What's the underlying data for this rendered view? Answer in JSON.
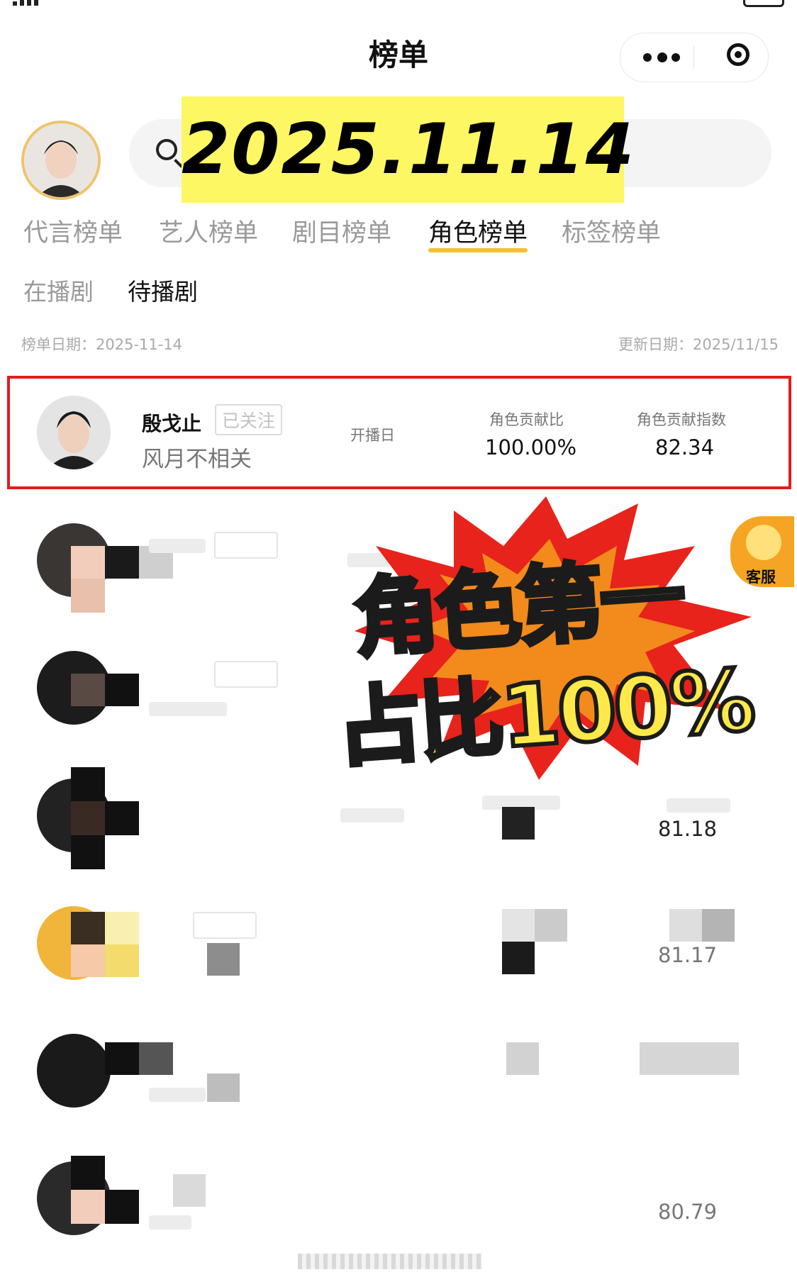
{
  "nav": {
    "title": "榜单"
  },
  "header": {
    "search_icon": "search-icon",
    "date_banner": "2025.11.14"
  },
  "tabs": [
    {
      "label": "代言榜单",
      "active": false
    },
    {
      "label": "艺人榜单",
      "active": false
    },
    {
      "label": "剧目榜单",
      "active": false
    },
    {
      "label": "角色榜单",
      "active": true
    },
    {
      "label": "标签榜单",
      "active": false
    }
  ],
  "subtabs": [
    {
      "label": "在播剧",
      "active": false
    },
    {
      "label": "待播剧",
      "active": true
    }
  ],
  "meta": {
    "list_date": "榜单日期：2025-11-14",
    "update_date": "更新日期：2025/11/15"
  },
  "columns": {
    "start_date": "开播日",
    "contribution_ratio": "角色贡献比",
    "contribution_index": "角色贡献指数"
  },
  "rows": [
    {
      "name": "殷戈止",
      "follow": "已关注",
      "drama": "风月不相关",
      "ratio": "100.00%",
      "index": "82.34",
      "highlighted": true
    },
    {
      "index": "81.18"
    },
    {
      "index": "81.17"
    },
    {
      "index": "80.79"
    }
  ],
  "sticker": {
    "line1": "角色第一",
    "line2": "占比100%",
    "colors": {
      "fill": "#ffe94a",
      "burst": "#e8231b",
      "burst_inner": "#f28a1c"
    }
  },
  "float_service": {
    "label": "客服"
  },
  "colors": {
    "accent": "#f2c12e",
    "highlight_border": "#e21c1c",
    "banner": "#fdf763"
  }
}
